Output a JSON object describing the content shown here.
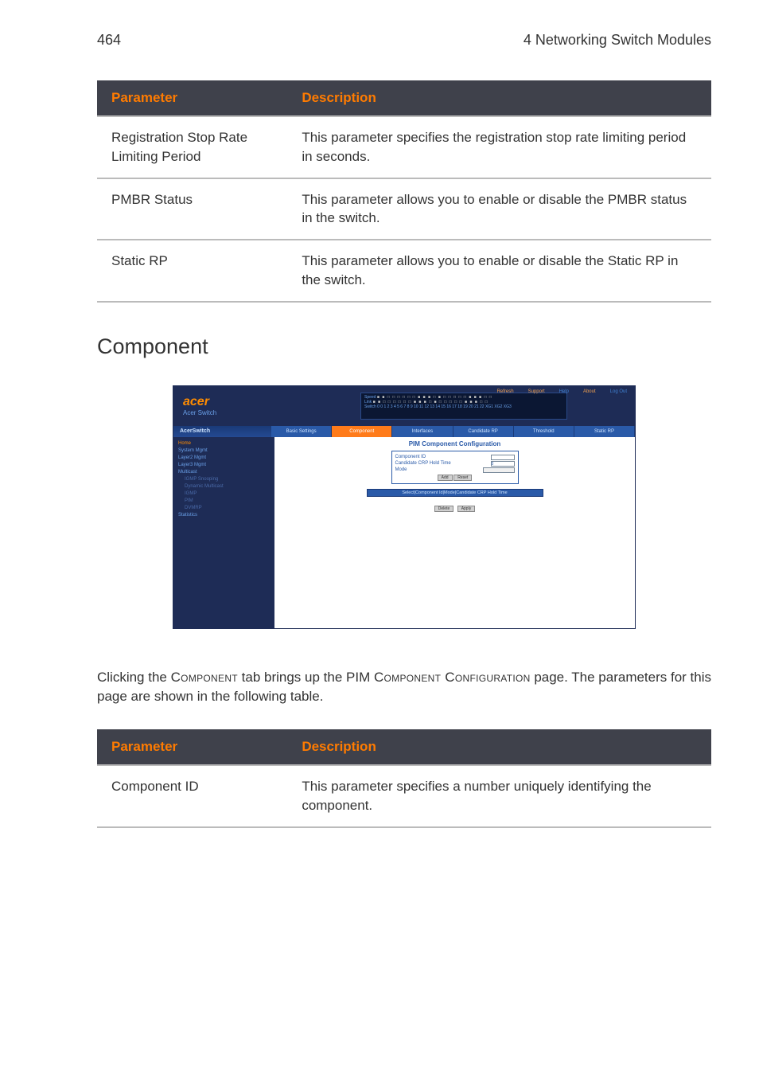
{
  "header": {
    "pageNumber": "464",
    "chapter": "4 Networking Switch Modules"
  },
  "table1": {
    "head": {
      "param": "Parameter",
      "desc": "Description"
    },
    "rows": [
      {
        "param": "Registration Stop Rate Limiting Period",
        "desc": "This parameter specifies the registration stop rate limiting period in seconds."
      },
      {
        "param": "PMBR Status",
        "desc": "This parameter allows you to enable or disable the PMBR status in the switch."
      },
      {
        "param": "Static RP",
        "desc": "This parameter allows you to enable or disable the Static RP in the switch."
      }
    ]
  },
  "sectionTitle": "Component",
  "screenshot": {
    "brand": "acer",
    "brandSub": "Acer Switch",
    "topLinks": [
      "Refresh",
      "Support",
      "Help",
      "About",
      "Log Out"
    ],
    "panelLines": [
      "Speed",
      "Link",
      "Switch 0 0 1 2 3 4 5 6 7 8 9 10 11 12 13 14 15 16 17 18 19 20 21 22 XG1 XG2 XG3"
    ],
    "navLeft": "AcerSwitch",
    "navTabs": [
      "Basic Settings",
      "Component",
      "Interfaces",
      "Candidate RP",
      "Threshold",
      "Static RP"
    ],
    "sidebar": {
      "home": "Home",
      "items": [
        "System Mgmt",
        "Layer2 Mgmt",
        "Layer3 Mgmt",
        "Multicast"
      ],
      "sub": [
        "IGMP Snooping",
        "Dynamic Multicast",
        "IGMP",
        "PIM",
        "DVMRP"
      ],
      "last": "Statistics"
    },
    "pageTitle": "PIM Component Configuration",
    "form": {
      "rows": [
        {
          "label": "Component ID",
          "kind": "input"
        },
        {
          "label": "Candidate CRP Hold Time",
          "kind": "input",
          "value": "0"
        },
        {
          "label": "Mode",
          "kind": "select"
        }
      ],
      "buttons": [
        "Add",
        "Reset"
      ]
    },
    "gridHeader": "Select|Component Id|Mode|Candidate CRP Hold Time",
    "gridButtons": [
      "Delete",
      "Apply"
    ]
  },
  "desc_parts": {
    "p1": "Clicking the ",
    "sc1": "Component",
    "p2": " tab brings up the PIM ",
    "sc2": "Component Configuration",
    "p3": " page. The parameters for this page are shown in the following table."
  },
  "table2": {
    "head": {
      "param": "Parameter",
      "desc": "Description"
    },
    "rows": [
      {
        "param": "Component ID",
        "desc": "This parameter specifies a number uniquely identifying the component."
      }
    ]
  }
}
